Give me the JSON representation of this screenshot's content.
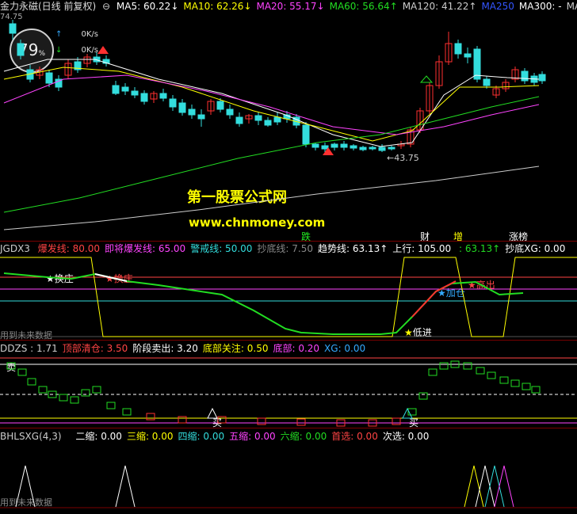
{
  "main": {
    "title": "金力永磁(日线 前复权)",
    "indicators": [
      {
        "label": "MA5: 60.22",
        "arrow": "↓",
        "color": "#ffffff"
      },
      {
        "label": "MA10: 62.26",
        "arrow": "↓",
        "color": "#ffff00"
      },
      {
        "label": "MA20: 55.17",
        "arrow": "↓",
        "color": "#ff44ff"
      },
      {
        "label": "MA60: 56.64",
        "arrow": "↑",
        "color": "#22dd22"
      },
      {
        "label": "MA120: 41.22",
        "arrow": "↑",
        "color": "#cccccc"
      },
      {
        "label": "MA250",
        "arrow": "",
        "color": "#3355ff"
      },
      {
        "label": "MA300: -",
        "arrow": "",
        "color": "#ffffff"
      },
      {
        "label": "MA",
        "arrow": "",
        "color": "#cccccc"
      }
    ],
    "price_top": "74.75",
    "price_low": "43.75",
    "badge_pct": "79",
    "badge_unit": "%",
    "up_speed": "0K/s",
    "down_speed": "0K/s",
    "watermark_cn": "第一股票公式网",
    "watermark_url": "www.chnmoney.com",
    "event_tags": [
      {
        "text": "跌",
        "color": "#22ee22"
      },
      {
        "text": "财",
        "color": "#ffffff"
      },
      {
        "text": "增",
        "color": "#ffff00"
      },
      {
        "text": "涨榜",
        "color": "#ffffff"
      }
    ]
  },
  "jgdx": {
    "name": "JGDX3",
    "items": [
      {
        "label": "爆发线: 80.00",
        "color": "#ff4444"
      },
      {
        "label": "即将爆发线: 65.00",
        "color": "#ff44ff"
      },
      {
        "label": "警戒线: 50.00",
        "color": "#33dddd"
      },
      {
        "label": "抄底线: 7.50",
        "color": "#888888"
      },
      {
        "label": "趋势线: 63.13↑",
        "color": "#ffffff"
      },
      {
        "label": "上行: 105.00",
        "color": "#ffffff"
      },
      {
        "label": "  : 63.13↑",
        "color": "#22dd22"
      },
      {
        "label": "抄底XG: 0.00",
        "color": "#ffffff"
      }
    ],
    "annotations": {
      "huanzhuang1": "换庄",
      "huanzhuang2": "换庄",
      "dijin": "低进",
      "jiacang": "加仓",
      "gaochu": "高出"
    }
  },
  "ddzs": {
    "name": "DDZS",
    "items": [
      {
        "label": ": 1.71",
        "color": "#cccccc"
      },
      {
        "label": "顶部清仓: 3.50",
        "color": "#ff4444"
      },
      {
        "label": "阶段卖出: 3.20",
        "color": "#ffffff"
      },
      {
        "label": "底部关注: 0.50",
        "color": "#ffff00"
      },
      {
        "label": "底部: 0.20",
        "color": "#ff44ff"
      },
      {
        "label": "XG: 0.00",
        "color": "#33aaff"
      }
    ],
    "sell": "卖",
    "buy1": "买",
    "buy2": "买"
  },
  "bhlsxg": {
    "name": "BHLSXG(4,3)",
    "items": [
      {
        "label": "二缩: 0.00",
        "color": "#ffffff"
      },
      {
        "label": "三缩: 0.00",
        "color": "#ffff00"
      },
      {
        "label": "四缩: 0.00",
        "color": "#33dddd"
      },
      {
        "label": "五缩: 0.00",
        "color": "#ff44ff"
      },
      {
        "label": "六缩: 0.00",
        "color": "#22dd22"
      },
      {
        "label": "首选: 0.00",
        "color": "#ff4444"
      },
      {
        "label": "次选: 0.00",
        "color": "#ffffff"
      }
    ]
  },
  "future_data_label": "用到未来数据"
}
